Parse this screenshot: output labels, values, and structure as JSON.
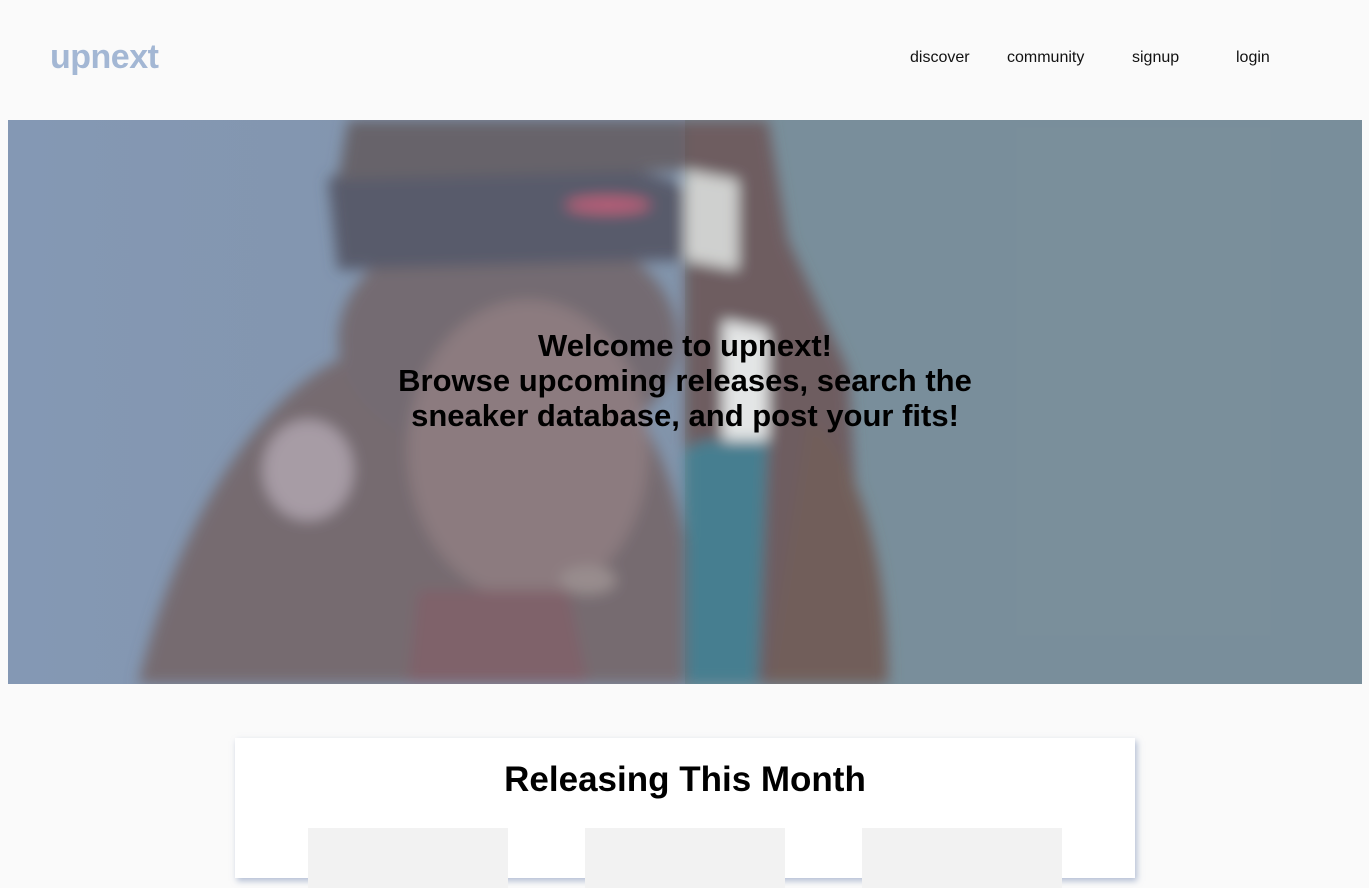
{
  "header": {
    "logo": "upnext",
    "nav": [
      {
        "label": "discover"
      },
      {
        "label": "community"
      },
      {
        "label": "signup"
      },
      {
        "label": "login"
      }
    ]
  },
  "hero": {
    "line1": "Welcome to upnext!",
    "line2": "Browse upcoming releases, search the sneaker database, and post your fits!"
  },
  "releases": {
    "title": "Releasing This Month",
    "slot_count_visible": 3
  },
  "colors": {
    "logo": "#a3b7d4",
    "background": "#fafafa",
    "hero_tint": "#7b8fa3"
  }
}
